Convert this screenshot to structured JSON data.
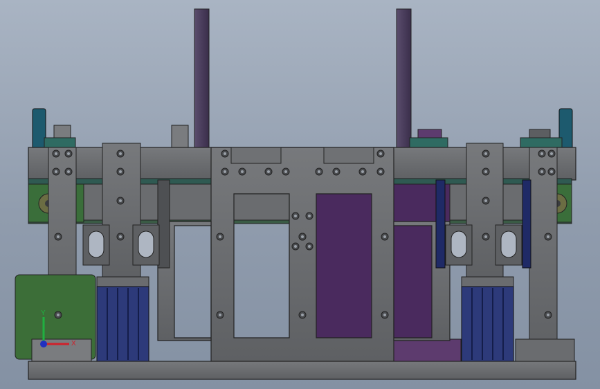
{
  "viewport": {
    "background_top": "#a9b4c3",
    "background_bottom": "#8491a3"
  },
  "colors": {
    "steel": "#6b6d70",
    "steel_dark": "#4e5053",
    "purple": "#4a2a5e",
    "purple_light": "#5d3b6e",
    "rod": "#4b3f5c",
    "green": "#3c6e38",
    "teal": "#1d5a6e",
    "navy": "#1f2a66",
    "hole": "#3a3c3f"
  },
  "triad": {
    "x_label": "X",
    "y_label": "Y",
    "x_color": "#d0202a",
    "y_color": "#20b040",
    "z_color": "#2030c0"
  }
}
